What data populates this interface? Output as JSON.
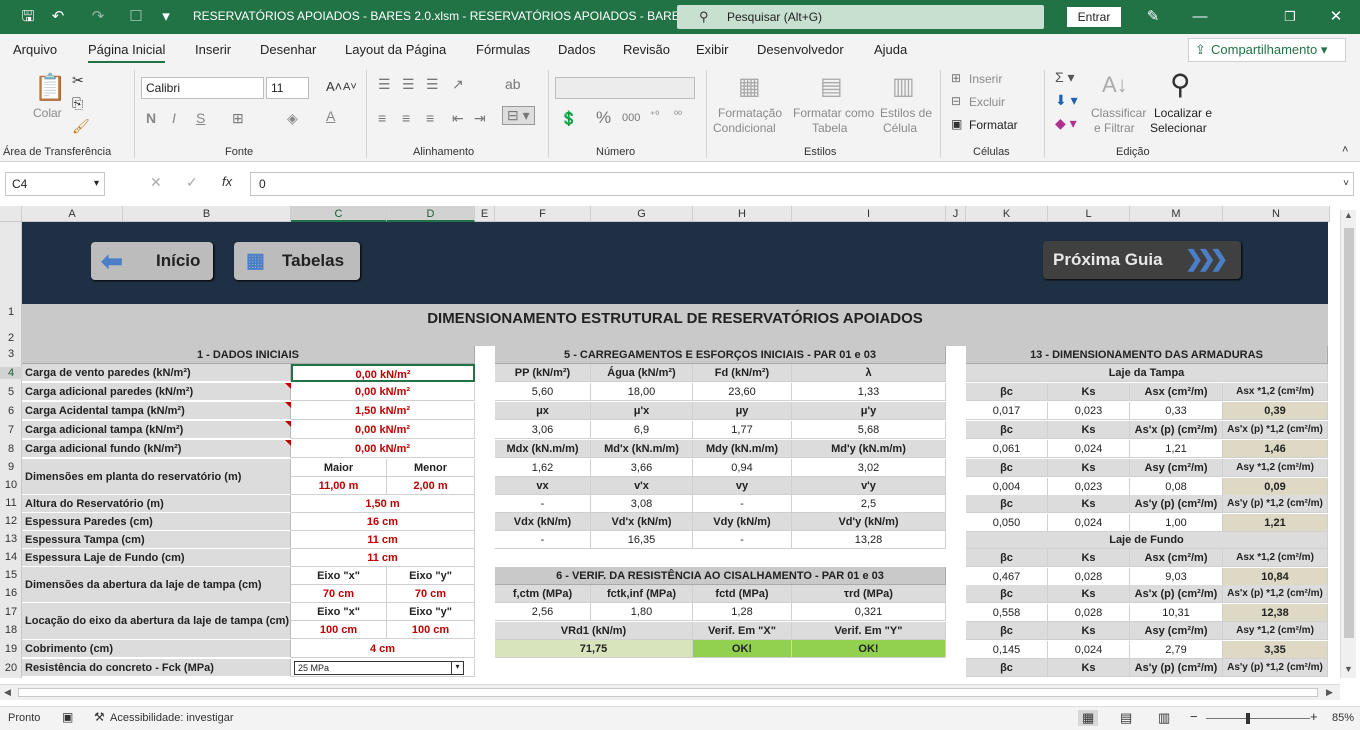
{
  "titlebar": {
    "title": "RESERVATÓRIOS APOIADOS - BARES 2.0.xlsm  -  RESERVATÓRIOS APOIADOS - BARES 2.05",
    "search_placeholder": "Pesquisar (Alt+G)",
    "signin_label": "Entrar"
  },
  "menu": {
    "items": [
      "Arquivo",
      "Página Inicial",
      "Inserir",
      "Desenhar",
      "Layout da Página",
      "Fórmulas",
      "Dados",
      "Revisão",
      "Exibir",
      "Desenvolvedor",
      "Ajuda"
    ],
    "share_label": "Compartilhamento"
  },
  "ribbon": {
    "clipboard": {
      "paste": "Colar",
      "label": "Área de Transferência"
    },
    "font": {
      "name": "Calibri",
      "size": "11",
      "label": "Fonte"
    },
    "alignment": {
      "label": "Alinhamento"
    },
    "number": {
      "label": "Número"
    },
    "styles": {
      "cond": "Formatação",
      "cond2": "Condicional",
      "table": "Formatar como",
      "table2": "Tabela",
      "cell": "Estilos de",
      "cell2": "Célula",
      "label": "Estilos"
    },
    "cells": {
      "insert": "Inserir",
      "delete": "Excluir",
      "format": "Formatar",
      "label": "Células"
    },
    "editing": {
      "sort": "Classificar",
      "sort2": "e Filtrar",
      "find": "Localizar e",
      "find2": "Selecionar",
      "label": "Edição"
    }
  },
  "formula_bar": {
    "cell_ref": "C4",
    "formula": "0"
  },
  "columns": [
    "A",
    "B",
    "C",
    "D",
    "E",
    "F",
    "G",
    "H",
    "I",
    "J",
    "K",
    "L",
    "M",
    "N"
  ],
  "rows": [
    "1",
    "2",
    "3",
    "4",
    "5",
    "6",
    "7",
    "8",
    "9",
    "10",
    "11",
    "12",
    "13",
    "14",
    "15",
    "16",
    "17",
    "18",
    "19",
    "20"
  ],
  "nav": {
    "inicio": "Início",
    "tabelas": "Tabelas",
    "proxima": "Próxima Guia"
  },
  "main_title": "DIMENSIONAMENTO ESTRUTURAL DE RESERVATÓRIOS APOIADOS",
  "dados": {
    "header": "1 - DADOS INICIAIS",
    "l4": "Carga de vento paredes (kN/m²)",
    "v4": "0,00 kN/m²",
    "l5": "Carga adicional paredes (kN/m²)",
    "v5": "0,00 kN/m²",
    "l6": "Carga Acidental tampa (kN/m²)",
    "v6": "1,50 kN/m²",
    "l7": "Carga adicional tampa (kN/m²)",
    "v7": "0,00 kN/m²",
    "l8": "Carga adicional fundo (kN/m²)",
    "v8": "0,00 kN/m²",
    "l9": "Dimensões em planta do reservatório (m)",
    "maior": "Maior",
    "menor": "Menor",
    "v10a": "11,00 m",
    "v10b": "2,00 m",
    "l11": "Altura do Reservatório (m)",
    "v11": "1,50 m",
    "l12": "Espessura Paredes (cm)",
    "v12": "16 cm",
    "l13": "Espessura Tampa (cm)",
    "v13": "11 cm",
    "l14": "Espessura Laje de Fundo (cm)",
    "v14": "11 cm",
    "l15": "Dimensões da abertura da laje de tampa (cm)",
    "ex": "Eixo \"x\"",
    "ey": "Eixo \"y\"",
    "v16a": "70 cm",
    "v16b": "70 cm",
    "l17": "Locação do eixo da abertura da laje de tampa (cm)",
    "v18a": "100 cm",
    "v18b": "100 cm",
    "l19": "Cobrimento (cm)",
    "v19": "4 cm",
    "l20": "Resistência do concreto - Fck (MPa)",
    "v20": "25 MPa"
  },
  "cargas": {
    "header": "5 - CARREGAMENTOS E ESFORÇOS INICIAIS - PAR 01 e 03",
    "h1": [
      "PP (kN/m²)",
      "Água (kN/m²)",
      "Fd (kN/m²)",
      "λ"
    ],
    "r1": [
      "5,60",
      "18,00",
      "23,60",
      "1,33"
    ],
    "h2": [
      "μx",
      "μ'x",
      "μy",
      "μ'y"
    ],
    "r2": [
      "3,06",
      "6,9",
      "1,77",
      "5,68"
    ],
    "h3": [
      "Mdx (kN.m/m)",
      "Md'x (kN.m/m)",
      "Mdy (kN.m/m)",
      "Md'y (kN.m/m)"
    ],
    "r3": [
      "1,62",
      "3,66",
      "0,94",
      "3,02"
    ],
    "h4": [
      "vx",
      "v'x",
      "vy",
      "v'y"
    ],
    "r4": [
      "-",
      "3,08",
      "-",
      "2,5"
    ],
    "h5": [
      "Vdx (kN/m)",
      "Vd'x (kN/m)",
      "Vdy (kN/m)",
      "Vd'y (kN/m)"
    ],
    "r5": [
      "-",
      "16,35",
      "-",
      "13,28"
    ]
  },
  "cisalhamento": {
    "header": "6 - VERIF. DA RESISTÊNCIA AO CISALHAMENTO - PAR 01 e 03",
    "h1": [
      "f,ctm (MPa)",
      "fctk,inf (MPa)",
      "fctd (MPa)",
      "τrd (MPa)"
    ],
    "r1": [
      "2,56",
      "1,80",
      "1,28",
      "0,321"
    ],
    "h2": [
      "VRd1 (kN/m)",
      "Verif. Em \"X\"",
      "Verif. Em \"Y\""
    ],
    "r2": [
      "71,75",
      "OK!",
      "OK!"
    ]
  },
  "armaduras": {
    "header": "13 - DIMENSIONAMENTO DAS ARMADURAS",
    "tampa": "Laje da Tampa",
    "fundo": "Laje de Fundo",
    "rows": [
      {
        "h": [
          "βc",
          "Ks",
          "Asx (cm²/m)",
          "Asx *1,2 (cm²/m)"
        ],
        "v": [
          "0,017",
          "0,023",
          "0,33",
          "0,39"
        ]
      },
      {
        "h": [
          "βc",
          "Ks",
          "As'x (p) (cm²/m)",
          "As'x (p) *1,2 (cm²/m)"
        ],
        "v": [
          "0,061",
          "0,024",
          "1,21",
          "1,46"
        ]
      },
      {
        "h": [
          "βc",
          "Ks",
          "Asy (cm²/m)",
          "Asy *1,2 (cm²/m)"
        ],
        "v": [
          "0,004",
          "0,023",
          "0,08",
          "0,09"
        ]
      },
      {
        "h": [
          "βc",
          "Ks",
          "As'y (p) (cm²/m)",
          "As'y (p) *1,2 (cm²/m)"
        ],
        "v": [
          "0,050",
          "0,024",
          "1,00",
          "1,21"
        ]
      },
      {
        "h": [
          "βc",
          "Ks",
          "Asx (cm²/m)",
          "Asx *1,2 (cm²/m)"
        ],
        "v": [
          "0,467",
          "0,028",
          "9,03",
          "10,84"
        ]
      },
      {
        "h": [
          "βc",
          "Ks",
          "As'x (p) (cm²/m)",
          "As'x (p) *1,2 (cm²/m)"
        ],
        "v": [
          "0,558",
          "0,028",
          "10,31",
          "12,38"
        ]
      },
      {
        "h": [
          "βc",
          "Ks",
          "Asy (cm²/m)",
          "Asy *1,2 (cm²/m)"
        ],
        "v": [
          "0,145",
          "0,024",
          "2,79",
          "3,35"
        ]
      },
      {
        "h": [
          "βc",
          "Ks",
          "As'y (p) (cm²/m)",
          "As'y (p) *1,2 (cm²/m)"
        ]
      }
    ]
  },
  "status": {
    "ready": "Pronto",
    "accessibility": "Acessibilidade: investigar",
    "zoom": "85%"
  }
}
